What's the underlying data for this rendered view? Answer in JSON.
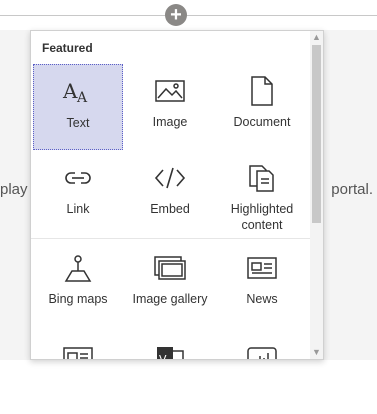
{
  "background": {
    "left_text": "play",
    "right_text": "portal."
  },
  "add_button": {
    "icon": "plus-icon",
    "symbol": "+"
  },
  "picker": {
    "section_title": "Featured",
    "items": [
      {
        "label": "Text",
        "icon": "text-icon",
        "selected": true
      },
      {
        "label": "Image",
        "icon": "image-icon"
      },
      {
        "label": "Document",
        "icon": "document-icon"
      },
      {
        "label": "Link",
        "icon": "link-icon"
      },
      {
        "label": "Embed",
        "icon": "embed-icon"
      },
      {
        "label": "Highlighted content",
        "icon": "highlighted-content-icon"
      },
      {
        "label": "Bing maps",
        "icon": "map-icon"
      },
      {
        "label": "Image gallery",
        "icon": "image-gallery-icon"
      },
      {
        "label": "News",
        "icon": "news-icon"
      },
      {
        "label": "",
        "icon": "news-reel-icon"
      },
      {
        "label": "",
        "icon": "visio-icon"
      },
      {
        "label": "",
        "icon": "chart-icon"
      }
    ]
  },
  "colors": {
    "selected_bg": "#d6d8ee",
    "icon_stroke": "#333333",
    "accent": "#5b5fc7"
  }
}
